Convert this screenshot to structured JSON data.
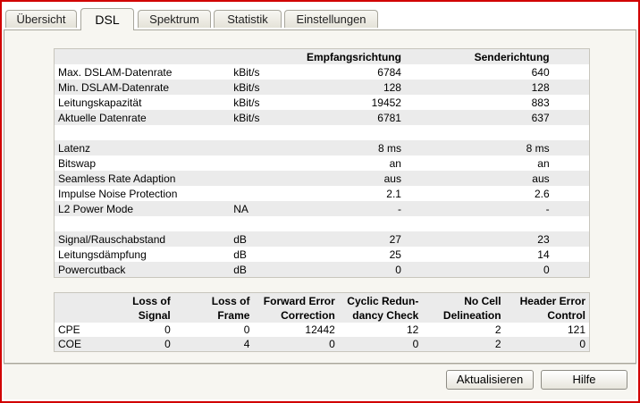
{
  "tabs": [
    {
      "label": "Übersicht"
    },
    {
      "label": "DSL"
    },
    {
      "label": "Spektrum"
    },
    {
      "label": "Statistik"
    },
    {
      "label": "Einstellungen"
    }
  ],
  "table1": {
    "col_down": "Empfangsrichtung",
    "col_up": "Senderichtung",
    "rows": [
      {
        "label": "Max. DSLAM-Datenrate",
        "unit": "kBit/s",
        "down": "6784",
        "up": "640"
      },
      {
        "label": "Min. DSLAM-Datenrate",
        "unit": "kBit/s",
        "down": "128",
        "up": "128"
      },
      {
        "label": "Leitungskapazität",
        "unit": "kBit/s",
        "down": "19452",
        "up": "883"
      },
      {
        "label": "Aktuelle Datenrate",
        "unit": "kBit/s",
        "down": "6781",
        "up": "637"
      },
      {
        "label": "Latenz",
        "unit": "",
        "down": "8 ms",
        "up": "8 ms"
      },
      {
        "label": "Bitswap",
        "unit": "",
        "down": "an",
        "up": "an"
      },
      {
        "label": "Seamless Rate Adaption",
        "unit": "",
        "down": "aus",
        "up": "aus"
      },
      {
        "label": "Impulse Noise Protection",
        "unit": "",
        "down": "2.1",
        "up": "2.6"
      },
      {
        "label": "L2 Power Mode",
        "unit": "NA",
        "down": "-",
        "up": "-"
      },
      {
        "label": "Signal/Rauschabstand",
        "unit": "dB",
        "down": "27",
        "up": "23"
      },
      {
        "label": "Leitungsdämpfung",
        "unit": "dB",
        "down": "25",
        "up": "14"
      },
      {
        "label": "Powercutback",
        "unit": "dB",
        "down": "0",
        "up": "0"
      }
    ]
  },
  "table2": {
    "headers": [
      [
        "Loss of",
        "Signal"
      ],
      [
        "Loss of",
        "Frame"
      ],
      [
        "Forward Error",
        "Correction"
      ],
      [
        "Cyclic Redun-",
        "dancy Check"
      ],
      [
        "No Cell",
        "Delineation"
      ],
      [
        "Header Error",
        "Control"
      ]
    ],
    "rows": [
      {
        "label": "CPE",
        "values": [
          "0",
          "0",
          "12442",
          "12",
          "2",
          "121"
        ]
      },
      {
        "label": "COE",
        "values": [
          "0",
          "4",
          "0",
          "0",
          "2",
          "0"
        ]
      }
    ]
  },
  "buttons": {
    "refresh": "Aktualisieren",
    "help": "Hilfe"
  },
  "colors": {
    "window_border": "#d10000",
    "panel_bg": "#f7f6f1",
    "row_alt": "#ebebeb"
  }
}
